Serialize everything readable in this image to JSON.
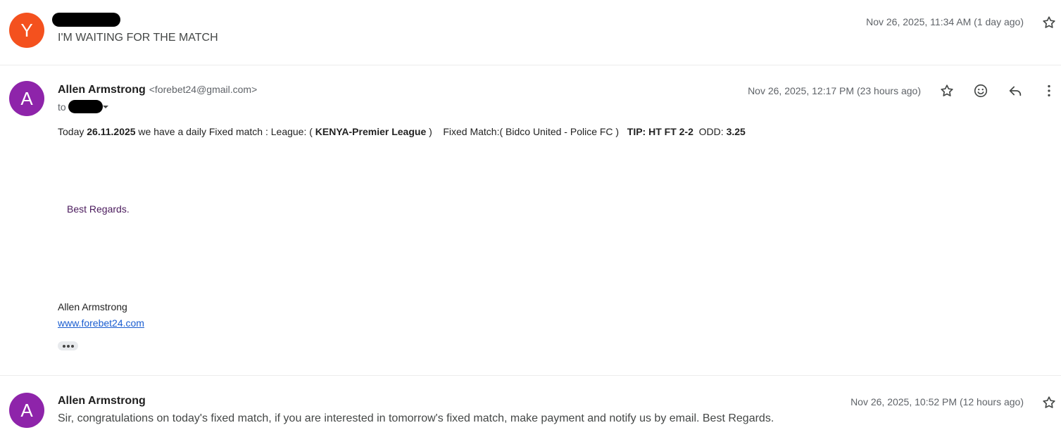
{
  "messages": [
    {
      "avatar_letter": "Y",
      "avatar_color": "#f4511e",
      "snippet": "I'M WAITING FOR THE MATCH",
      "date": "Nov 26, 2025, 11:34 AM (1 day ago)"
    },
    {
      "avatar_letter": "A",
      "avatar_color": "#8e24aa",
      "sender_name": "Allen Armstrong",
      "sender_email": "<forebet24@gmail.com>",
      "to_prefix": "to",
      "date": "Nov 26, 2025, 12:17 PM (23 hours ago)",
      "body": {
        "p1_a": "Today ",
        "p1_date": "26.11.2025",
        "p1_b": " we have a daily Fixed match : League: ( ",
        "p1_league": "KENYA-Premier League",
        "p1_c": " )    Fixed Match:( Bidco United - Police FC )   ",
        "p1_tip": "TIP: HT FT 2-2",
        "p1_d": "  ODD: ",
        "p1_odd": "3.25",
        "regards": "Best Regards.",
        "sig_name": "Allen Armstrong",
        "sig_link": "www.forebet24.com"
      }
    },
    {
      "avatar_letter": "A",
      "avatar_color": "#8e24aa",
      "sender_name": "Allen Armstrong",
      "snippet": "Sir, congratulations on today's fixed match, if you are interested in tomorrow's fixed match, make payment and notify us by email. Best Regards.",
      "date": "Nov 26, 2025, 10:52 PM (12 hours ago)"
    }
  ],
  "icons": {
    "star": "star-icon",
    "emoji": "emoji-icon",
    "reply": "reply-icon",
    "more": "more-vert-icon",
    "dropdown": "chevron-down-icon",
    "expand": "show-trimmed-content-icon"
  },
  "colors": {
    "link": "#1a5dd0",
    "regards": "#4a1a5c"
  }
}
